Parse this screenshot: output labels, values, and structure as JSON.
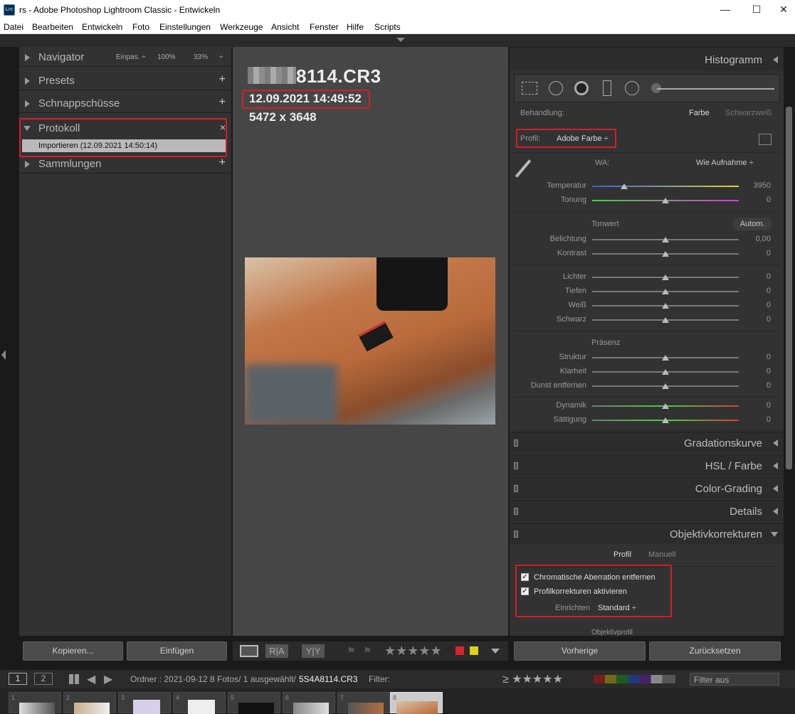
{
  "window": {
    "app_icon": "Lrc",
    "title": "rs - Adobe Photoshop Lightroom Classic - Entwickeln",
    "minimize": "—",
    "maximize": "☐",
    "close": "✕"
  },
  "menu": [
    "Datei",
    "Bearbeiten",
    "Entwickeln",
    "Foto",
    "Einstellungen",
    "Werkzeuge",
    "Ansicht",
    "Fenster",
    "Hilfe",
    "Scripts"
  ],
  "left": {
    "navigator": {
      "label": "Navigator",
      "fit": "Einpas. ÷",
      "z1": "100%",
      "z2": "33%",
      "z3": "÷"
    },
    "presets": {
      "label": "Presets",
      "action": "+"
    },
    "snapshots": {
      "label": "Schnappschüsse",
      "action": "+"
    },
    "history": {
      "label": "Protokoll",
      "close": "×",
      "item": "Importieren (12.09.2021 14:50:14)"
    },
    "collections": {
      "label": "Sammlungen",
      "action": "+"
    },
    "copy_button": "Kopieren...",
    "paste_button": "Einfügen"
  },
  "center": {
    "filename": "8114.CR3",
    "date": "12.09.2021 14:49:52",
    "dimensions": "5472 x 3648"
  },
  "toolbar": {
    "view_icon": "loupe-icon",
    "before_after": "R|A",
    "yy": "Y|Y",
    "stars": "★★★★★",
    "labels": [
      "#d9262a",
      "#dcd21c"
    ]
  },
  "right": {
    "histogram": "Histogramm",
    "treatment": {
      "label": "Behandlung:",
      "color": "Farbe",
      "bw": "Schwarzweiß"
    },
    "profile": {
      "label": "Profil:",
      "value": "Adobe Farbe ÷"
    },
    "wb": {
      "label": "WA:",
      "value": "Wie Aufnahme ÷"
    },
    "sliders_wb": [
      {
        "label": "Temperatur",
        "value": "3950",
        "pos": 0.22
      },
      {
        "label": "Tonung",
        "value": "0",
        "pos": 0.5
      }
    ],
    "tonwert": {
      "label": "Tonwert",
      "auto": "Autom."
    },
    "sliders_tone1": [
      {
        "label": "Belichtung",
        "value": "0,00",
        "pos": 0.5
      },
      {
        "label": "Kontrast",
        "value": "0",
        "pos": 0.5
      }
    ],
    "sliders_tone2": [
      {
        "label": "Lichter",
        "value": "0",
        "pos": 0.5
      },
      {
        "label": "Tiefen",
        "value": "0",
        "pos": 0.5
      },
      {
        "label": "Weiß",
        "value": "0",
        "pos": 0.5
      },
      {
        "label": "Schwarz",
        "value": "0",
        "pos": 0.5
      }
    ],
    "praesenz": "Präsenz",
    "sliders_presence1": [
      {
        "label": "Struktur",
        "value": "0",
        "pos": 0.5
      },
      {
        "label": "Klarheit",
        "value": "0",
        "pos": 0.5
      },
      {
        "label": "Dunst entfernen",
        "value": "0",
        "pos": 0.5
      }
    ],
    "sliders_presence2": [
      {
        "label": "Dynamik",
        "value": "0",
        "pos": 0.5
      },
      {
        "label": "Sättigung",
        "value": "0",
        "pos": 0.5
      }
    ],
    "panels": [
      "Gradationskurve",
      "HSL / Farbe",
      "Color-Grading",
      "Details"
    ],
    "lens": {
      "label": "Objektivkorrekturen",
      "tab_profile": "Profil",
      "tab_manual": "Manuell",
      "ca": "Chromatische Aberration entfernen",
      "profile_corr": "Profilkorrekturen aktivieren",
      "setup_label": "Einrichten",
      "setup_value": "Standard ÷",
      "next": "Objektivprofil"
    },
    "prev_button": "Vorherige",
    "reset_button": "Zurücksetzen"
  },
  "filmbar": {
    "page1": "1",
    "page2": "2",
    "folder": "Ordner : 2021-09-12",
    "count": "8 Fotos/ 1 ausgewählt/",
    "file": "5S4A8114.CR3",
    "filter": "Filter:",
    "filter_value": "Filter aus",
    "stars": "≥ ★★★★★"
  },
  "thumbs": [
    "1",
    "2",
    "3",
    "4",
    "5",
    "6",
    "7",
    "8"
  ]
}
